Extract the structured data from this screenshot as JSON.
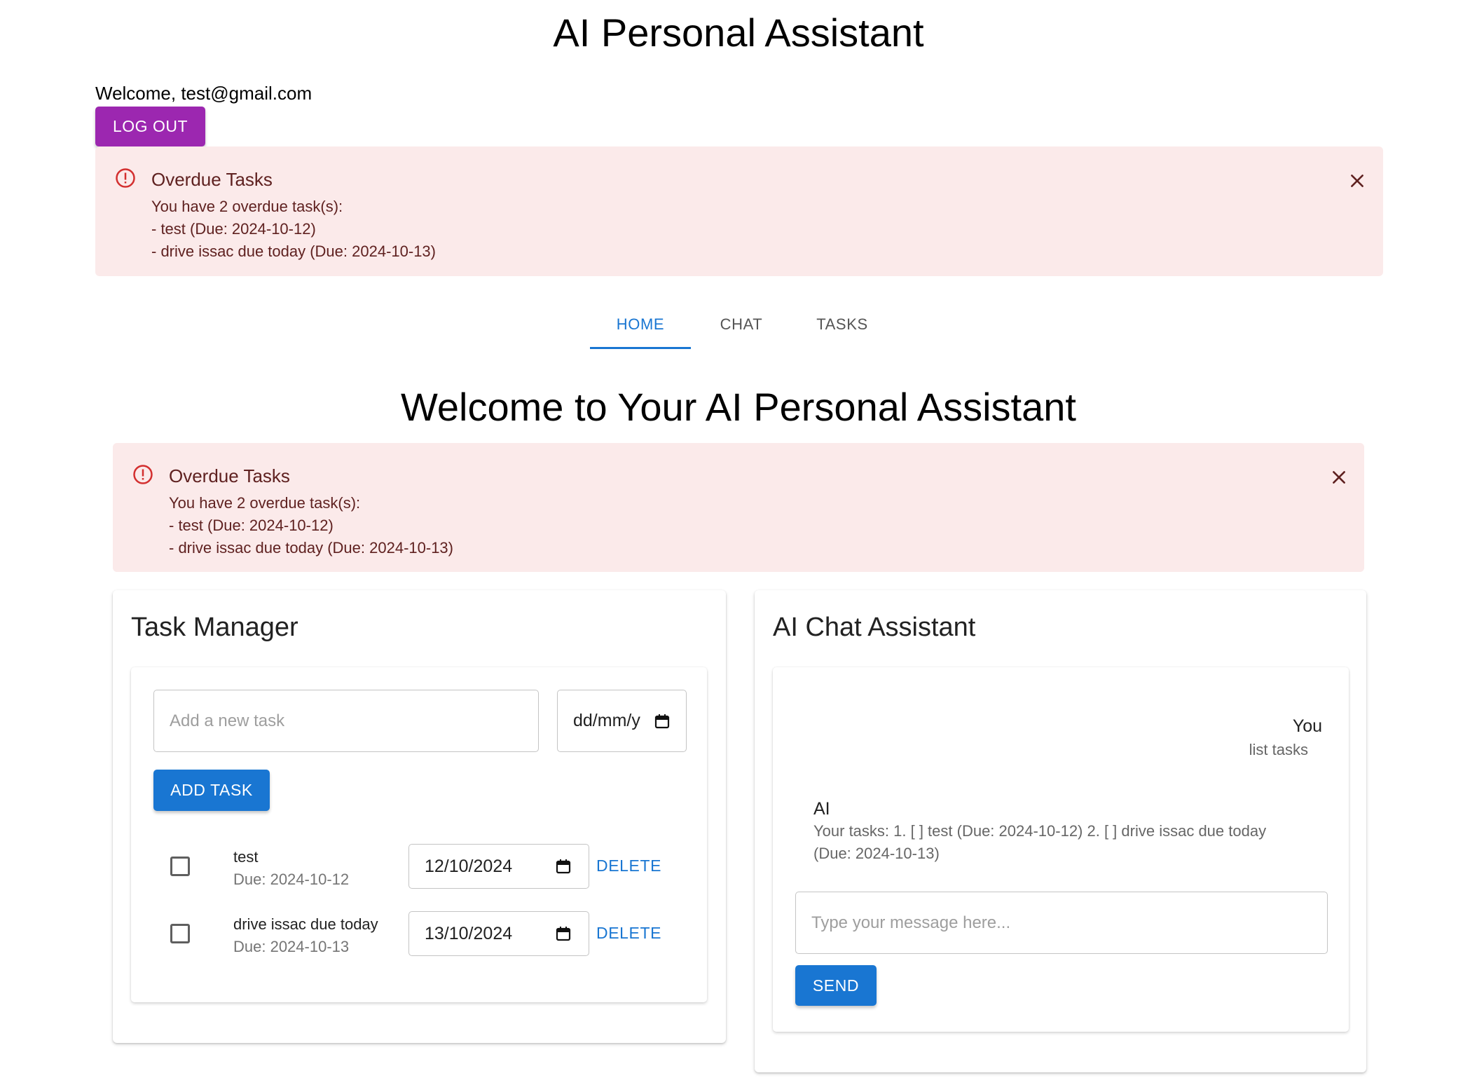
{
  "app": {
    "title": "AI Personal Assistant",
    "welcome": "Welcome, test@gmail.com",
    "logout_label": "LOG OUT"
  },
  "alert": {
    "title": "Overdue Tasks",
    "lines": [
      "You have 2 overdue task(s):",
      "- test (Due: 2024-10-12)",
      "- drive issac due today (Due: 2024-10-13)"
    ],
    "icon": "error-outline-icon",
    "close_icon": "close-icon"
  },
  "tabs": [
    {
      "label": "HOME",
      "active": true
    },
    {
      "label": "CHAT",
      "active": false
    },
    {
      "label": "TASKS",
      "active": false
    }
  ],
  "home": {
    "heading": "Welcome to Your AI Personal Assistant"
  },
  "task_manager": {
    "title": "Task Manager",
    "new_task_placeholder": "Add a new task",
    "date_placeholder": "dd/mm/y",
    "add_label": "ADD TASK",
    "delete_label": "DELETE",
    "tasks": [
      {
        "name": "test",
        "due": "Due: 2024-10-12",
        "date_value": "12/10/2024",
        "done": false
      },
      {
        "name": "drive issac due today",
        "due": "Due: 2024-10-13",
        "date_value": "13/10/2024",
        "done": false
      }
    ]
  },
  "chat": {
    "title": "AI Chat Assistant",
    "messages": [
      {
        "sender": "You",
        "text": "list tasks"
      },
      {
        "sender": "AI",
        "text": "Your tasks: 1. [ ] test (Due: 2024-10-12) 2. [ ] drive issac due today (Due: 2024-10-13)"
      }
    ],
    "input_placeholder": "Type your message here...",
    "send_label": "SEND"
  },
  "colors": {
    "logout": "#9c27b0",
    "primary": "#1976d2",
    "alert_bg": "#fbeaea",
    "alert_text": "#5f2120",
    "alert_icon": "#d32f2f"
  }
}
